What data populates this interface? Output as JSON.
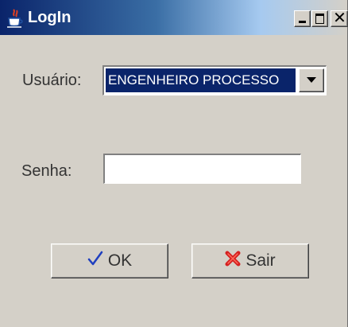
{
  "window": {
    "title": "LogIn",
    "icon": "java-cup-icon",
    "controls": {
      "minimize": "minimize-icon",
      "maximize": "maximize-icon",
      "close": "✕"
    }
  },
  "form": {
    "user_label": "Usuário:",
    "user_selected": "ENGENHEIRO PROCESSO",
    "password_label": "Senha:",
    "password_value": ""
  },
  "buttons": {
    "ok_label": "OK",
    "ok_icon": "checkmark-icon",
    "exit_label": "Sair",
    "exit_icon": "red-x-icon"
  },
  "colors": {
    "title_bar": "#0a246a",
    "window_bg": "#d4d0c8",
    "selection": "#0a246a",
    "check": "#1f3fbf",
    "exit_x": "#d42020"
  }
}
